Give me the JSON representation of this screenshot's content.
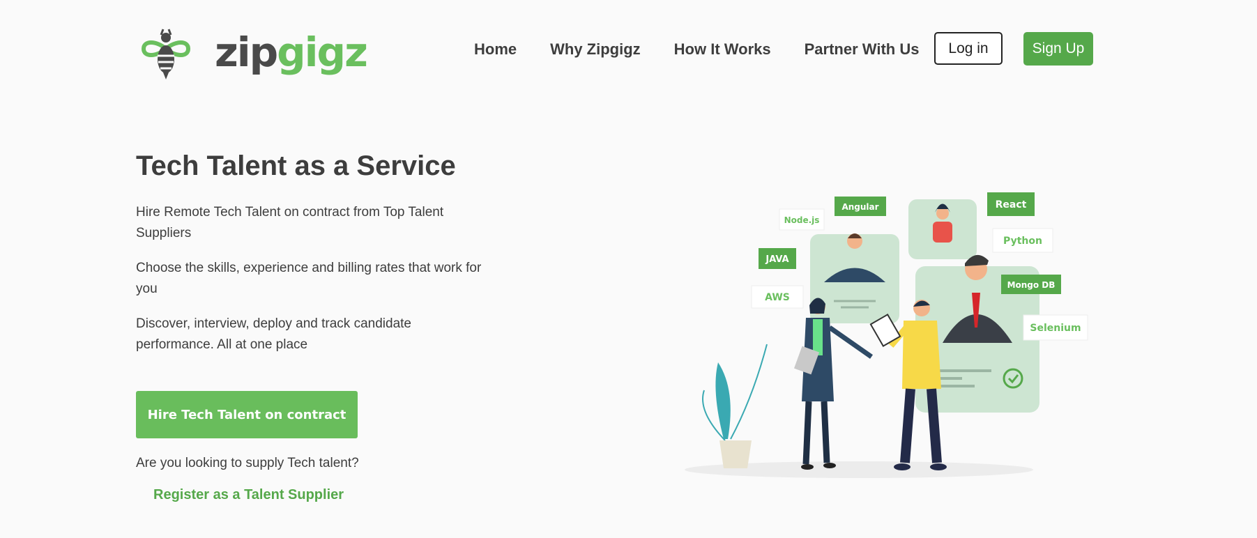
{
  "logo": {
    "text_zip": "zip",
    "text_gigz": "gigz",
    "icon": "bee-icon"
  },
  "nav": {
    "items": [
      {
        "label": "Home"
      },
      {
        "label": "Why Zipgigz"
      },
      {
        "label": "How It Works"
      },
      {
        "label": "Partner With Us"
      }
    ],
    "login_label": "Log in",
    "signup_label": "Sign Up"
  },
  "hero": {
    "title": "Tech Talent as a Service",
    "p1": "Hire Remote Tech Talent on contract from Top Talent Suppliers",
    "p2": "Choose the skills, experience and billing rates that work for you",
    "p3": "Discover, interview, deploy and track candidate performance. All at one place",
    "cta_label": "Hire Tech Talent on contract",
    "supply_question": "Are you looking to supply Tech talent?",
    "supplier_link": "Register as a Talent Supplier"
  },
  "illustration": {
    "tags": [
      "Node.js",
      "Angular",
      "React",
      "Python",
      "JAVA",
      "AWS",
      "Mongo DB",
      "Selenium"
    ]
  },
  "colors": {
    "brand_green": "#55a84a",
    "cta_green": "#69bd5c",
    "text": "#3d3d3d"
  }
}
